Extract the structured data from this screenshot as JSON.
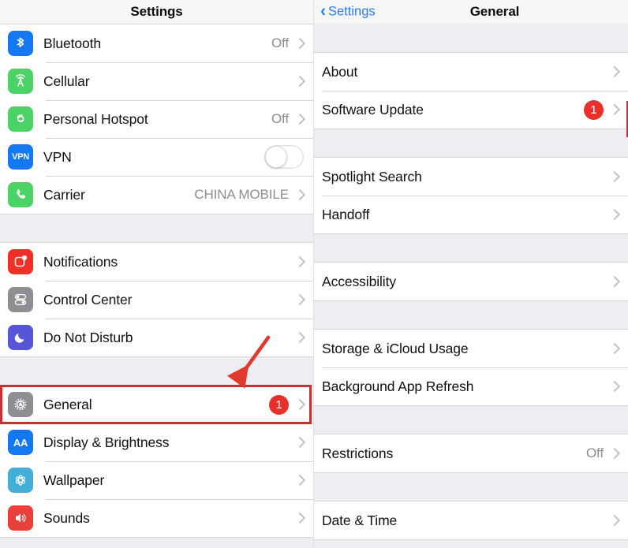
{
  "left_panel": {
    "nav": {
      "title": "Settings"
    },
    "groups": [
      {
        "id": "connectivity",
        "rows": [
          {
            "label": "Bluetooth",
            "value": "Off",
            "icon": "bluetooth-icon",
            "icon_color": "#1478f0",
            "accessory": "chevron"
          },
          {
            "label": "Cellular",
            "value": "",
            "icon": "cellular-icon",
            "icon_color": "#4cd267",
            "accessory": "chevron"
          },
          {
            "label": "Personal Hotspot",
            "value": "Off",
            "icon": "personal-hotspot-icon",
            "icon_color": "#4cd267",
            "accessory": "chevron"
          },
          {
            "label": "VPN",
            "value": "",
            "icon": "vpn-icon",
            "icon_color": "#1478f0",
            "accessory": "toggle",
            "toggle_state": "off"
          },
          {
            "label": "Carrier",
            "value": "CHINA MOBILE",
            "icon": "phone-icon",
            "icon_color": "#4cd267",
            "accessory": "chevron"
          }
        ]
      },
      {
        "id": "alerts",
        "rows": [
          {
            "label": "Notifications",
            "value": "",
            "icon": "notifications-icon",
            "icon_color": "#f03028",
            "accessory": "chevron"
          },
          {
            "label": "Control Center",
            "value": "",
            "icon": "control-center-icon",
            "icon_color": "#8e8e93",
            "accessory": "chevron"
          },
          {
            "label": "Do Not Disturb",
            "value": "",
            "icon": "do-not-disturb-icon",
            "icon_color": "#5656d6",
            "accessory": "chevron"
          }
        ]
      },
      {
        "id": "system",
        "rows": [
          {
            "label": "General",
            "value": "",
            "icon": "gear-icon",
            "icon_color": "#8e8e93",
            "accessory": "chevron",
            "badge": "1",
            "highlighted": true
          },
          {
            "label": "Display & Brightness",
            "value": "",
            "icon": "display-brightness-icon",
            "icon_color": "#1478f0",
            "accessory": "chevron"
          },
          {
            "label": "Wallpaper",
            "value": "",
            "icon": "wallpaper-icon",
            "icon_color": "#45aed6",
            "accessory": "chevron"
          },
          {
            "label": "Sounds",
            "value": "",
            "icon": "sounds-icon",
            "icon_color": "#e8403a",
            "accessory": "chevron"
          }
        ]
      }
    ]
  },
  "right_panel": {
    "nav": {
      "back_label": "Settings",
      "title": "General"
    },
    "groups": [
      {
        "id": "about-group",
        "rows": [
          {
            "label": "About",
            "value": "",
            "accessory": "chevron"
          },
          {
            "label": "Software Update",
            "value": "",
            "accessory": "chevron",
            "badge": "1",
            "highlighted": true
          }
        ]
      },
      {
        "id": "search-group",
        "rows": [
          {
            "label": "Spotlight Search",
            "value": "",
            "accessory": "chevron"
          },
          {
            "label": "Handoff",
            "value": "",
            "accessory": "chevron"
          }
        ]
      },
      {
        "id": "accessibility-group",
        "rows": [
          {
            "label": "Accessibility",
            "value": "",
            "accessory": "chevron"
          }
        ]
      },
      {
        "id": "storage-group",
        "rows": [
          {
            "label": "Storage & iCloud Usage",
            "value": "",
            "accessory": "chevron"
          },
          {
            "label": "Background App Refresh",
            "value": "",
            "accessory": "chevron"
          }
        ]
      },
      {
        "id": "restrictions-group",
        "rows": [
          {
            "label": "Restrictions",
            "value": "Off",
            "accessory": "chevron"
          }
        ]
      },
      {
        "id": "datetime-group",
        "rows": [
          {
            "label": "Date & Time",
            "value": "",
            "accessory": "chevron"
          }
        ]
      }
    ]
  },
  "annotations": {
    "highlight_color": "#c7302c",
    "arrow_color": "#e03a2f",
    "badge_color": "#e8302a",
    "accent_color": "#2b7df6",
    "highlighted_items": [
      "General",
      "Software Update"
    ]
  }
}
